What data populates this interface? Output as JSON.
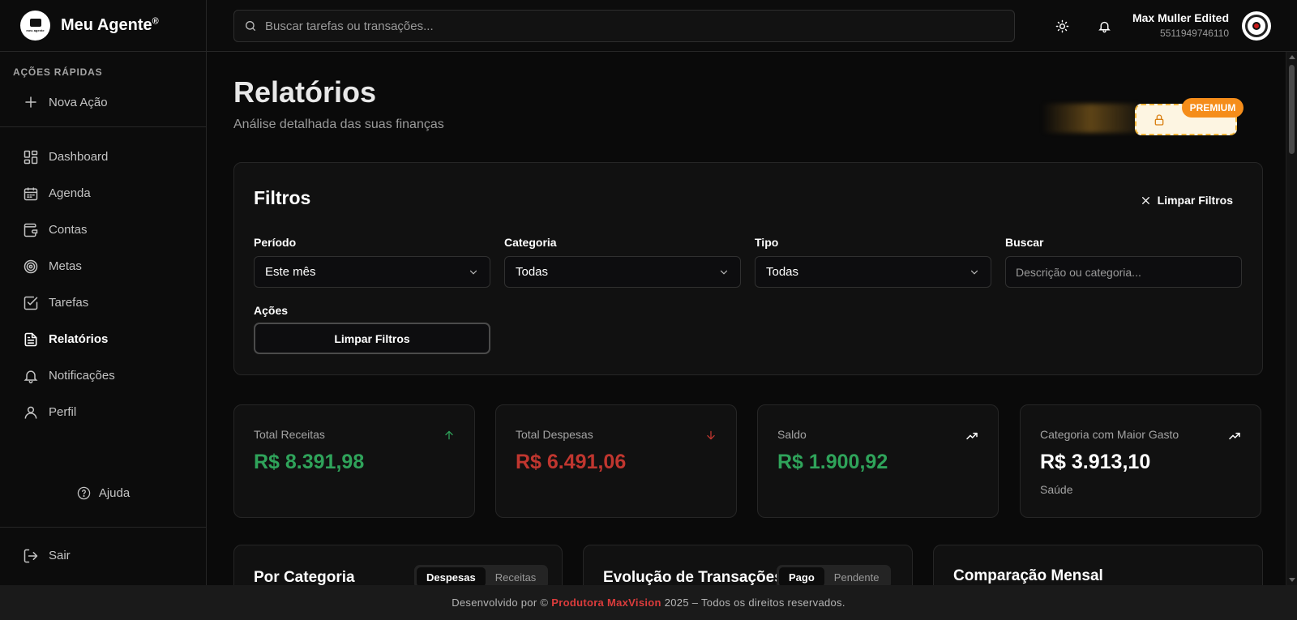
{
  "brand": {
    "name": "Meu Agente",
    "reg": "®",
    "logo_text": "meu agente"
  },
  "header": {
    "search_placeholder": "Buscar tarefas ou transações...",
    "user_name": "Max Muller Edited",
    "user_phone": "5511949746110"
  },
  "sidebar": {
    "quick_label": "AÇÕES RÁPIDAS",
    "new_action": "Nova Ação",
    "items": [
      {
        "label": "Dashboard",
        "icon": "dashboard-icon"
      },
      {
        "label": "Agenda",
        "icon": "calendar-icon"
      },
      {
        "label": "Contas",
        "icon": "wallet-icon"
      },
      {
        "label": "Metas",
        "icon": "target-icon"
      },
      {
        "label": "Tarefas",
        "icon": "checkbox-icon"
      },
      {
        "label": "Relatórios",
        "icon": "report-icon",
        "active": true
      },
      {
        "label": "Notificações",
        "icon": "bell-icon"
      },
      {
        "label": "Perfil",
        "icon": "user-icon"
      }
    ],
    "help": "Ajuda",
    "logout": "Sair"
  },
  "page": {
    "title": "Relatórios",
    "subtitle": "Análise detalhada das suas finanças",
    "premium_badge": "PREMIUM"
  },
  "filters": {
    "title": "Filtros",
    "clear_top": "Limpar Filtros",
    "periodo_label": "Período",
    "periodo_value": "Este mês",
    "categoria_label": "Categoria",
    "categoria_value": "Todas",
    "tipo_label": "Tipo",
    "tipo_value": "Todas",
    "buscar_label": "Buscar",
    "buscar_placeholder": "Descrição ou categoria...",
    "acoes_label": "Ações",
    "acoes_button": "Limpar Filtros"
  },
  "stats": [
    {
      "label": "Total Receitas",
      "value": "R$ 8.391,98",
      "color": "#2fa35a",
      "icon": "arrow-up-icon"
    },
    {
      "label": "Total Despesas",
      "value": "R$ 6.491,06",
      "color": "#c0362f",
      "icon": "arrow-down-icon"
    },
    {
      "label": "Saldo",
      "value": "R$ 1.900,92",
      "color": "#2fa35a",
      "icon": "trending-up-icon"
    },
    {
      "label": "Categoria com Maior Gasto",
      "value": "R$ 3.913,10",
      "sub": "Saúde",
      "color": "#ffffff",
      "icon": "trending-up-icon"
    }
  ],
  "charts": {
    "categoria_title": "Por Categoria",
    "categoria_opt1": "Despesas",
    "categoria_opt2": "Receitas",
    "evolucao_title": "Evolução de Transações",
    "evolucao_opt1": "Pago",
    "evolucao_opt2": "Pendente",
    "comparacao_title": "Comparação Mensal"
  },
  "footer": {
    "prefix": "Desenvolvido por ©",
    "brand": "Produtora MaxVision",
    "suffix": "2025 – Todos os direitos reservados."
  }
}
